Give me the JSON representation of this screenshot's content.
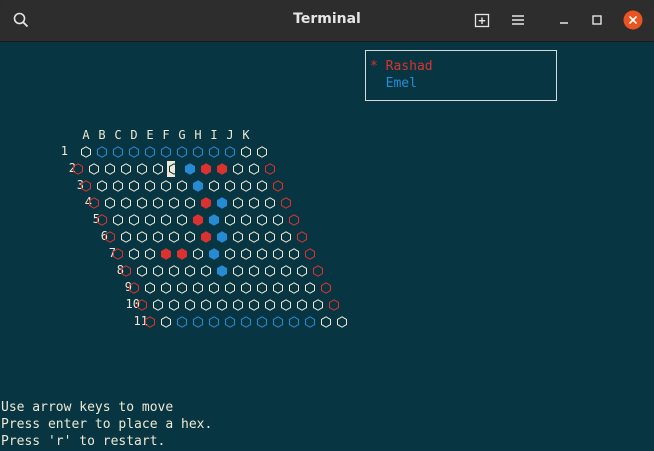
{
  "window": {
    "title": "Terminal"
  },
  "players": [
    {
      "marker": "*",
      "name": "Rashad",
      "color": "#dc322f"
    },
    {
      "marker": " ",
      "name": "Emel",
      "color": "#268bd2"
    }
  ],
  "columns": [
    "A",
    "B",
    "C",
    "D",
    "E",
    "F",
    "G",
    "H",
    "I",
    "J",
    "K"
  ],
  "rows": [
    "1",
    "2",
    "3",
    "4",
    "5",
    "6",
    "7",
    "8",
    "9",
    "10",
    "11"
  ],
  "colors": {
    "red": "#dc322f",
    "blue": "#268bd2",
    "empty": "#eee8d5",
    "cursor_bg": "#eee8d5"
  },
  "board": {
    "cursor": [
      1,
      5
    ],
    "red_stones": [
      [
        1,
        7
      ],
      [
        1,
        8
      ],
      [
        3,
        6
      ],
      [
        4,
        5
      ],
      [
        5,
        5
      ],
      [
        6,
        2
      ],
      [
        6,
        3
      ]
    ],
    "blue_stones": [
      [
        1,
        6
      ],
      [
        2,
        6
      ],
      [
        3,
        7
      ],
      [
        4,
        6
      ],
      [
        5,
        6
      ],
      [
        6,
        5
      ],
      [
        7,
        5
      ]
    ]
  },
  "messages": [
    "Use arrow keys to move",
    "Press enter to place a hex.",
    "Press 'r' to restart."
  ]
}
